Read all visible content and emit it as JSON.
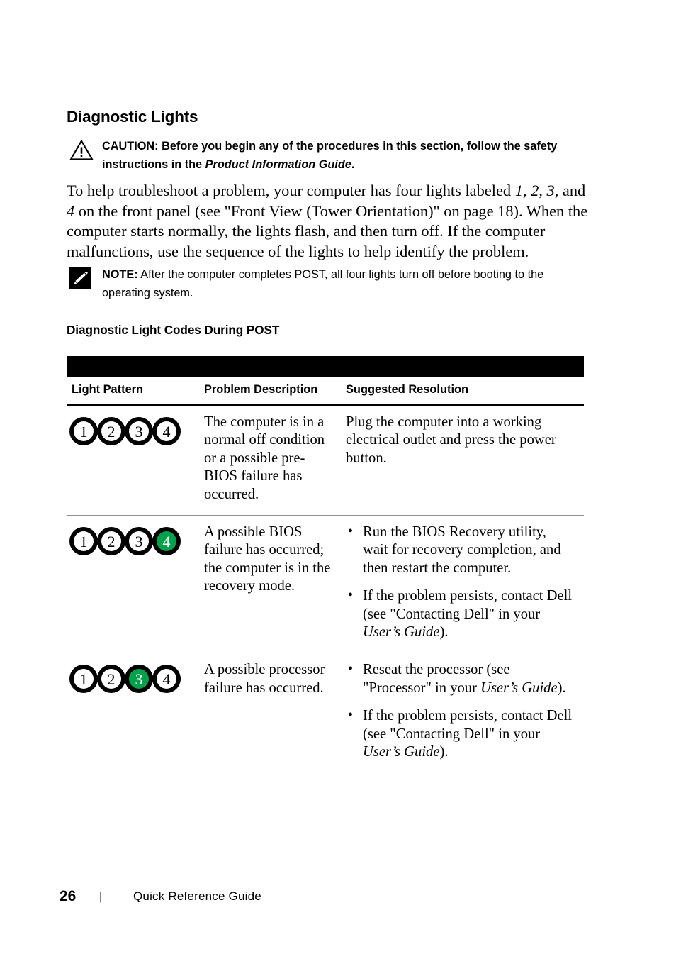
{
  "section": {
    "heading": "Diagnostic Lights",
    "subheading": "Diagnostic Light Codes During POST"
  },
  "caution": {
    "icon": "warning-triangle-icon",
    "label": "CAUTION:",
    "text_before": " Before you begin any of the procedures in this section, follow the safety instructions in the ",
    "emphasis": "Product Information Guide",
    "text_after": "."
  },
  "paragraph": {
    "p1_a": "To help troubleshoot a problem, your computer has four lights labeled ",
    "p1_i1": "1",
    "p1_b": ", ",
    "p1_i2": "2",
    "p1_c": ", ",
    "p1_i3": "3",
    "p1_d": ", and ",
    "p1_i4": "4",
    "p1_e": " on the front panel (see \"Front View (Tower Orientation)\" on page 18). When the computer starts normally, the lights flash, and then turn off. If the computer malfunctions, use the sequence of the lights to help identify the problem."
  },
  "note": {
    "icon": "note-pencil-icon",
    "label": "NOTE:",
    "text": " After the computer completes POST, all four lights turn off before booting to the operating system."
  },
  "table": {
    "headers": {
      "pattern": "Light Pattern",
      "problem": "Problem Description",
      "resolution": "Suggested Resolution"
    },
    "rows": [
      {
        "lights": [
          {
            "number": "1",
            "state": "off"
          },
          {
            "number": "2",
            "state": "off"
          },
          {
            "number": "3",
            "state": "off"
          },
          {
            "number": "4",
            "state": "off"
          }
        ],
        "problem": "The computer is in a normal off condition or a possible pre-BIOS failure has occurred.",
        "resolution_paragraph": "Plug the computer into a working electrical outlet and press the power button.",
        "resolution_bullets": []
      },
      {
        "lights": [
          {
            "number": "1",
            "state": "off"
          },
          {
            "number": "2",
            "state": "off"
          },
          {
            "number": "3",
            "state": "off"
          },
          {
            "number": "4",
            "state": "on"
          }
        ],
        "problem": "A possible BIOS failure has occurred; the computer is in the recovery mode.",
        "resolution_paragraph": "",
        "resolution_bullets": [
          {
            "text_a": "Run the BIOS Recovery utility, wait for recovery completion, and then restart the computer.",
            "emphasis": "",
            "text_b": ""
          },
          {
            "text_a": "If the problem persists, contact Dell (see \"Contacting Dell\" in your ",
            "emphasis": "User’s Guide",
            "text_b": ")."
          }
        ]
      },
      {
        "lights": [
          {
            "number": "1",
            "state": "off"
          },
          {
            "number": "2",
            "state": "off"
          },
          {
            "number": "3",
            "state": "on"
          },
          {
            "number": "4",
            "state": "off"
          }
        ],
        "problem": "A possible processor failure has occurred.",
        "resolution_paragraph": "",
        "resolution_bullets": [
          {
            "text_a": "Reseat the processor (see \"Processor\" in your ",
            "emphasis": "User’s Guide",
            "text_b": ")."
          },
          {
            "text_a": "If the problem persists, contact Dell (see \"Contacting Dell\" in your ",
            "emphasis": "User’s Guide",
            "text_b": ")."
          }
        ]
      }
    ]
  },
  "footer": {
    "page_number": "26",
    "separator": "|",
    "document_title": "Quick Reference Guide"
  },
  "colors": {
    "light_on": "#00A14B",
    "light_ring": "#000000",
    "rule": "#000000",
    "row_rule": "#8d8d8d"
  }
}
